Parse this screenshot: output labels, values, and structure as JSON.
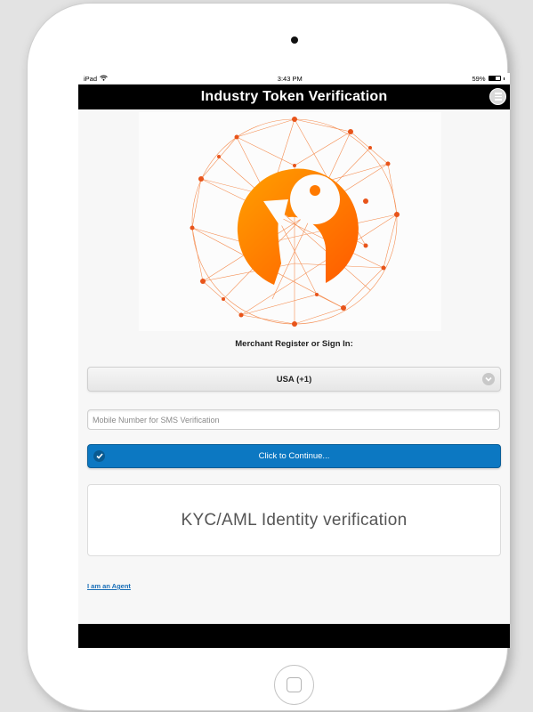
{
  "status_bar": {
    "device": "iPad",
    "time": "3:43 PM",
    "battery": "59%"
  },
  "header": {
    "title": "Industry Token Verification",
    "menu_icon": "menu-icon"
  },
  "form": {
    "prompt": "Merchant Register or Sign In:",
    "country_select": {
      "selected": "USA (+1)",
      "icon": "chevron-down-icon"
    },
    "mobile_input": {
      "value": "",
      "placeholder": "Mobile Number for SMS Verification"
    },
    "continue_button": {
      "label": "Click to Continue...",
      "icon": "check-icon"
    }
  },
  "kyc_card": {
    "text": "KYC/AML Identity verification"
  },
  "agent_link": {
    "label": "I am an Agent"
  },
  "colors": {
    "accent": "#0c78c2",
    "logo_orange": "#ff7a00",
    "header_bg": "#000000"
  }
}
